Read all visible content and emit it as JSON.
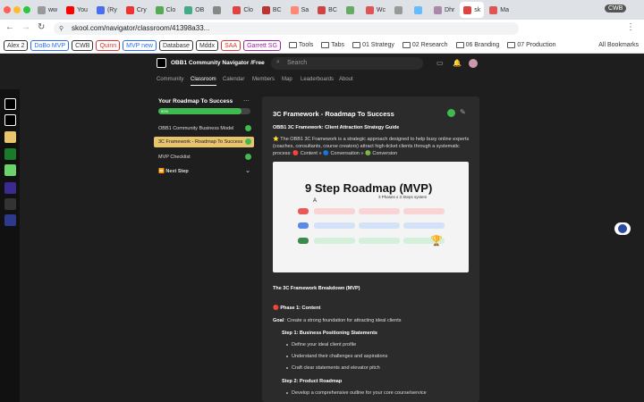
{
  "browser": {
    "tabs": [
      {
        "label": "ww",
        "active": false
      },
      {
        "label": "You",
        "active": false
      },
      {
        "label": "(Ry",
        "active": false
      },
      {
        "label": "Cry",
        "active": false
      },
      {
        "label": "Clo",
        "active": false
      },
      {
        "label": "OB",
        "active": false
      },
      {
        "label": "",
        "active": false
      },
      {
        "label": "Clo",
        "active": false
      },
      {
        "label": "BC",
        "active": false
      },
      {
        "label": "Sa",
        "active": false
      },
      {
        "label": "BC",
        "active": false
      },
      {
        "label": "",
        "active": false
      },
      {
        "label": "Wc",
        "active": false
      },
      {
        "label": "",
        "active": false
      },
      {
        "label": "",
        "active": false
      },
      {
        "label": "Dhr",
        "active": false
      },
      {
        "label": "sk",
        "active": true
      },
      {
        "label": "Ma",
        "active": false
      }
    ],
    "profile_label": "CWB",
    "url": "skool.com/navigator/classroom/41398a33...",
    "bookmarks_chips": [
      "Alex 2",
      "DoBo MVP",
      "CWB",
      "Quinn",
      "MVP new",
      "Database",
      "Mddx",
      "SAA",
      "Garrett SG"
    ],
    "bookmark_folders": [
      "Tools",
      "Tabs",
      "01 Strategy",
      "02 Research",
      "06 Branding",
      "07 Production"
    ],
    "all_bookmarks": "All Bookmarks"
  },
  "colors": {
    "accent": "#e8c46d",
    "success": "#3fb950",
    "bg": "#1e1e1e",
    "panel": "#2b2b2b"
  },
  "app": {
    "community_name": "OBB1 Community Navigator /Free",
    "search_placeholder": "Search",
    "nav_tabs": [
      "Community",
      "Classroom",
      "Calendar",
      "Members",
      "Map",
      "Leaderboards",
      "About"
    ],
    "active_tab": "Classroom"
  },
  "sidebar": {
    "course_title": "Your Roadmap To Success",
    "progress_label": "90%",
    "progress_value": 0.9,
    "items": [
      {
        "label": "OBB1 Community Business Model",
        "done": true,
        "selected": false
      },
      {
        "label": "3C Framework - Roadmap To Success",
        "done": true,
        "selected": true
      },
      {
        "label": "MVP Checklist",
        "done": true,
        "selected": false
      },
      {
        "label": "⏩ Next Step",
        "done": false,
        "selected": false
      }
    ]
  },
  "lesson": {
    "title": "3C Framework - Roadmap To Success",
    "subtitle": "OBB1 3C Framework: Client Attraction Strategy Guide",
    "intro_line1": "⭐ The OBB1 3C Framework is a strategic approach designed to help busy online experts",
    "intro_line2": "(coaches, consultants, course creators) attract high-ticket clients through a systematic",
    "intro_line3": "process: 🔴 Content » 🔵 Conversation » 🟢 Conversion",
    "image_title": "9 Step Roadmap (MVP)",
    "image_subtitle": "3 Phases x 3 Steps system",
    "image_marker": "A",
    "breakdown_title": "The 3C Framework Breakdown (MVP)",
    "phase1_title": "🔴 Phase 1: Content",
    "goal_label": "Goal",
    "goal_text": ": Create a strong foundation for attracting ideal clients",
    "step1_title": "Step 1: Business Positioning Statements",
    "step1_items": [
      "Define your ideal client profile",
      "Understand their challenges and aspirations",
      "Craft clear statements and elevator pitch"
    ],
    "step2_title": "Step 2: Product Roadmap",
    "step2_items": [
      "Develop a comprehensive outline for your core course/service"
    ]
  }
}
